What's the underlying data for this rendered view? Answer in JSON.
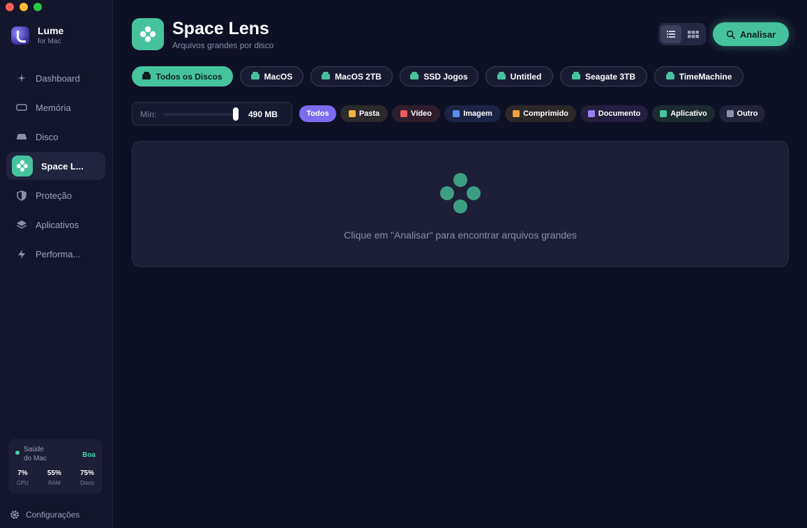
{
  "app": {
    "name": "Lume",
    "subtitle": "for Mac"
  },
  "sidebar": {
    "items": [
      {
        "label": "Dashboard",
        "icon": "sparkle-icon"
      },
      {
        "label": "Memória",
        "icon": "memory-icon"
      },
      {
        "label": "Disco",
        "icon": "disk-icon"
      },
      {
        "label": "Space L...",
        "icon": "space-lens-icon",
        "active": true
      },
      {
        "label": "Proteção",
        "icon": "shield-icon"
      },
      {
        "label": "Aplicativos",
        "icon": "layers-icon"
      },
      {
        "label": "Performa...",
        "icon": "bolt-icon"
      }
    ],
    "health": {
      "label": "Saúde do Mac",
      "status": "Boa",
      "stats": [
        {
          "value": "7%",
          "label": "CPU"
        },
        {
          "value": "55%",
          "label": "RAM"
        },
        {
          "value": "75%",
          "label": "Disco"
        }
      ]
    },
    "settings_label": "Configurações"
  },
  "header": {
    "title": "Space Lens",
    "subtitle": "Arquivos grandes por disco",
    "analyze_label": "Analisar"
  },
  "disks": [
    {
      "label": "Todos os Discos",
      "active": true
    },
    {
      "label": "MacOS"
    },
    {
      "label": "MacOS 2TB"
    },
    {
      "label": "SSD Jogos"
    },
    {
      "label": "Untitled"
    },
    {
      "label": "Seagate 3TB"
    },
    {
      "label": "TimeMachine"
    }
  ],
  "filter": {
    "min_label": "Mín:",
    "min_value": "490 MB",
    "types": [
      {
        "label": "Todos",
        "active": true,
        "color": "#7c6cf0"
      },
      {
        "label": "Pasta",
        "color": "#f2b33d"
      },
      {
        "label": "Vídeo",
        "color": "#f05a5a"
      },
      {
        "label": "Imagem",
        "color": "#5a8df0"
      },
      {
        "label": "Comprimido",
        "color": "#f2a13d"
      },
      {
        "label": "Documento",
        "color": "#9a7cf0"
      },
      {
        "label": "Aplicativo",
        "color": "#46c39d"
      },
      {
        "label": "Outro",
        "color": "#8c93b0"
      }
    ]
  },
  "empty_state": {
    "message": "Clique em \"Analisar\" para encontrar arquivos grandes"
  },
  "colors": {
    "accent": "#46c39d",
    "background": "#0e1024",
    "sidebar": "#14172b"
  }
}
